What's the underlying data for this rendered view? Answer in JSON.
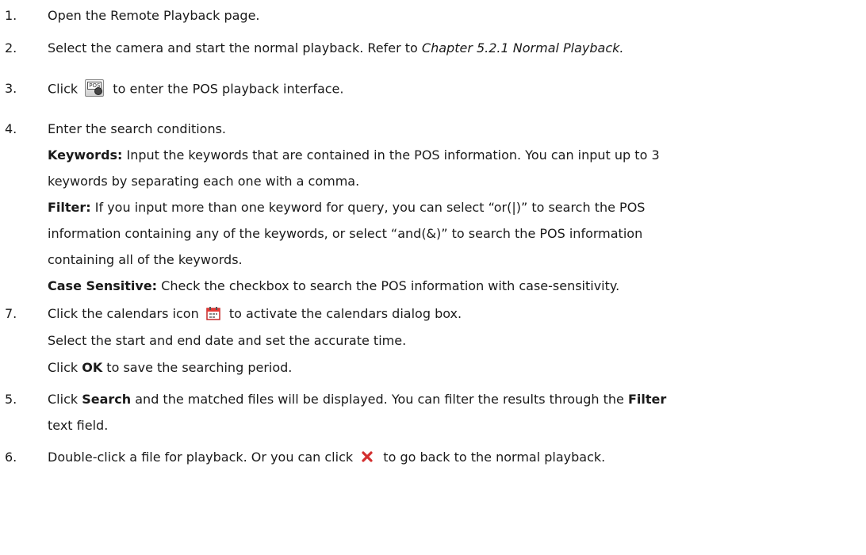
{
  "steps": [
    {
      "num": "1.",
      "text": "Open the Remote Playback page."
    },
    {
      "num": "2.",
      "pre": "Select the camera and start the normal playback. Refer to ",
      "ital": "Chapter 5.2.1 Normal Playback."
    },
    {
      "num": "3.",
      "pre": "Click ",
      "icon": "pos-playback-icon",
      "post": " to enter the POS playback interface."
    },
    {
      "num": "4.",
      "text": "Enter the search conditions.",
      "keywords_label": "Keywords:",
      "keywords_line1": " Input the keywords that are contained in the POS information. You can input up to 3",
      "keywords_line2": "keywords by separating each one with a comma.",
      "filter_label": "Filter:",
      "filter_line1": " If you input more than one keyword for query, you can select “or(|)” to search the POS",
      "filter_line2": "information containing any of the keywords, or select “and(&)” to search the POS information",
      "filter_line3": "containing all of the keywords.",
      "case_label": "Case Sensitive:",
      "case_line": " Check the checkbox to search the POS information with case-sensitivity."
    },
    {
      "num": "7.",
      "pre": "Click the calendars icon ",
      "icon": "calendar-icon",
      "post": " to activate the calendars dialog box.",
      "line2": "Select the start and end date and set the accurate time.",
      "line3_pre": "Click ",
      "line3_bold": "OK",
      "line3_post": " to save the searching period."
    },
    {
      "num": "5.",
      "pre": "Click ",
      "bold": "Search",
      "mid": " and the matched files will be displayed. You can filter the results through the ",
      "bold2": "Filter",
      "line2": "text field."
    },
    {
      "num": "6.",
      "pre": "Double-click a file for playback. Or you can click ",
      "icon": "close-icon",
      "post": " to go back to the normal playback."
    }
  ]
}
